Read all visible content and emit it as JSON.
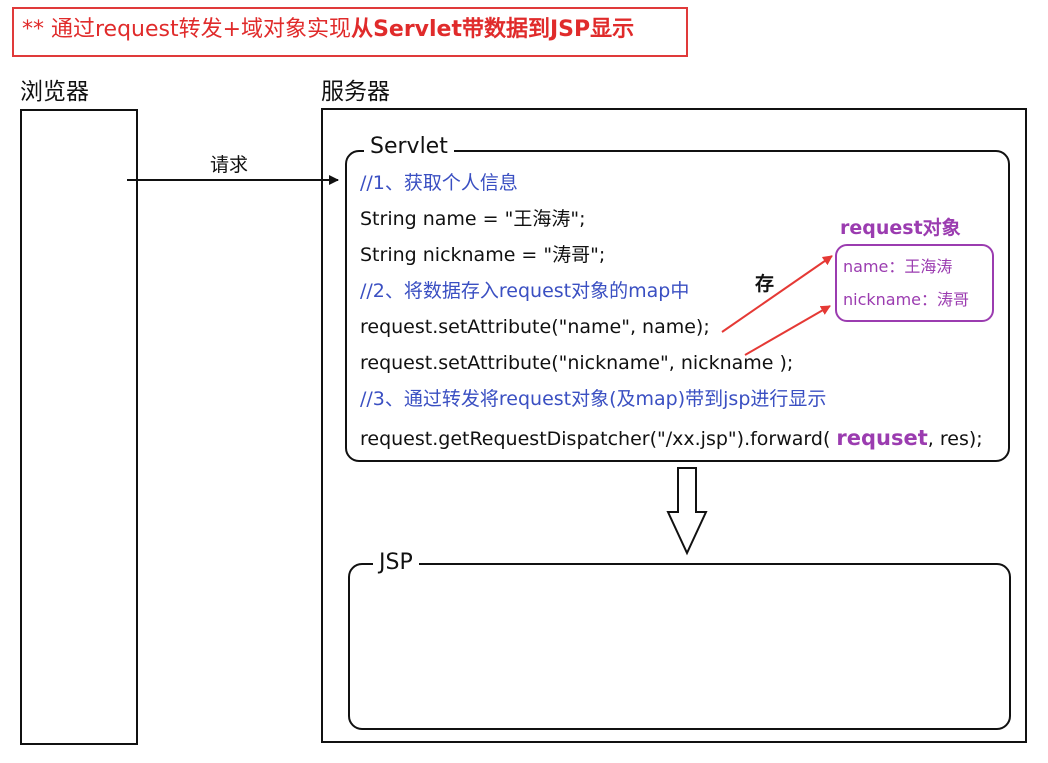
{
  "title": {
    "prefix": "** 通过request转发+域对象实现",
    "emphasis": "从Servlet带数据到JSP显示"
  },
  "browser": {
    "label": "浏览器"
  },
  "server": {
    "label": "服务器"
  },
  "request_arrow": {
    "label": "请求"
  },
  "servlet": {
    "label": "Servlet",
    "lines": {
      "l1": "//1、获取个人信息",
      "l2": "String name = \"王海涛\";",
      "l3": "String nickname = \"涛哥\";",
      "l4": "//2、将数据存入request对象的map中",
      "l5": "request.setAttribute(\"name\", name);",
      "l6": "request.setAttribute(\"nickname\", nickname );",
      "l7": "//3、通过转发将request对象(及map)带到jsp进行显示",
      "l8_prefix": "request.getRequestDispatcher(\"/xx.jsp\").forward( ",
      "l8_emphasis": "requset",
      "l8_suffix": ", res);"
    }
  },
  "request_object": {
    "title": "request对象",
    "items": [
      "name：王海涛",
      "nickname：涛哥"
    ]
  },
  "store_label": "存",
  "jsp": {
    "label": "JSP"
  },
  "colors": {
    "title_red": "#e02b2b",
    "comment_blue": "#3a4fc2",
    "purple": "#9b3cb0",
    "arrow_red": "#e53935"
  }
}
